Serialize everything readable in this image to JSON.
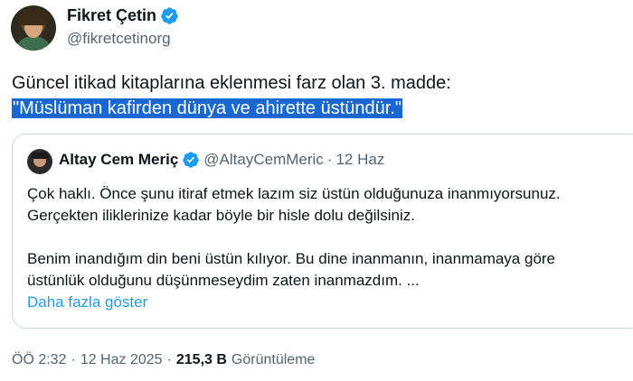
{
  "tweet": {
    "author": {
      "name": "Fikret Çetin",
      "handle": "@fikretcetinorg"
    },
    "text_line1": "Güncel itikad kitaplarına eklenmesi farz olan 3. madde:",
    "text_line2": "\"Müslüman kafirden dünya ve ahirette üstündür.\"",
    "quoted": {
      "author": {
        "name": "Altay Cem Meriç",
        "handle": "@AltayCemMeric",
        "separator": "·",
        "date": "12 Haz"
      },
      "lines": [
        "Çok haklı. Önce şunu itiraf etmek lazım siz üstün olduğunuza inanmıyorsunuz.",
        "Gerçekten iliklerinize kadar böyle bir hisle dolu değilsiniz.",
        "Benim inandığım din beni üstün kılıyor. Bu dine inanmanın, inanmamaya göre",
        "üstünlük olduğunu düşünmeseydim zaten inanmazdım. ..."
      ],
      "show_more": "Daha fazla göster"
    },
    "meta": {
      "time": "ÖÖ 2:32",
      "sep1": "·",
      "date": "12 Haz 2025",
      "sep2": "·",
      "views": "215,3 B",
      "views_label": "Görüntüleme"
    }
  },
  "colors": {
    "verified": "#1d9bf0",
    "link": "#1d9bf0",
    "highlight": "#1967d2",
    "muted": "#536471"
  },
  "icons": {
    "verified": "verified-badge-icon"
  }
}
